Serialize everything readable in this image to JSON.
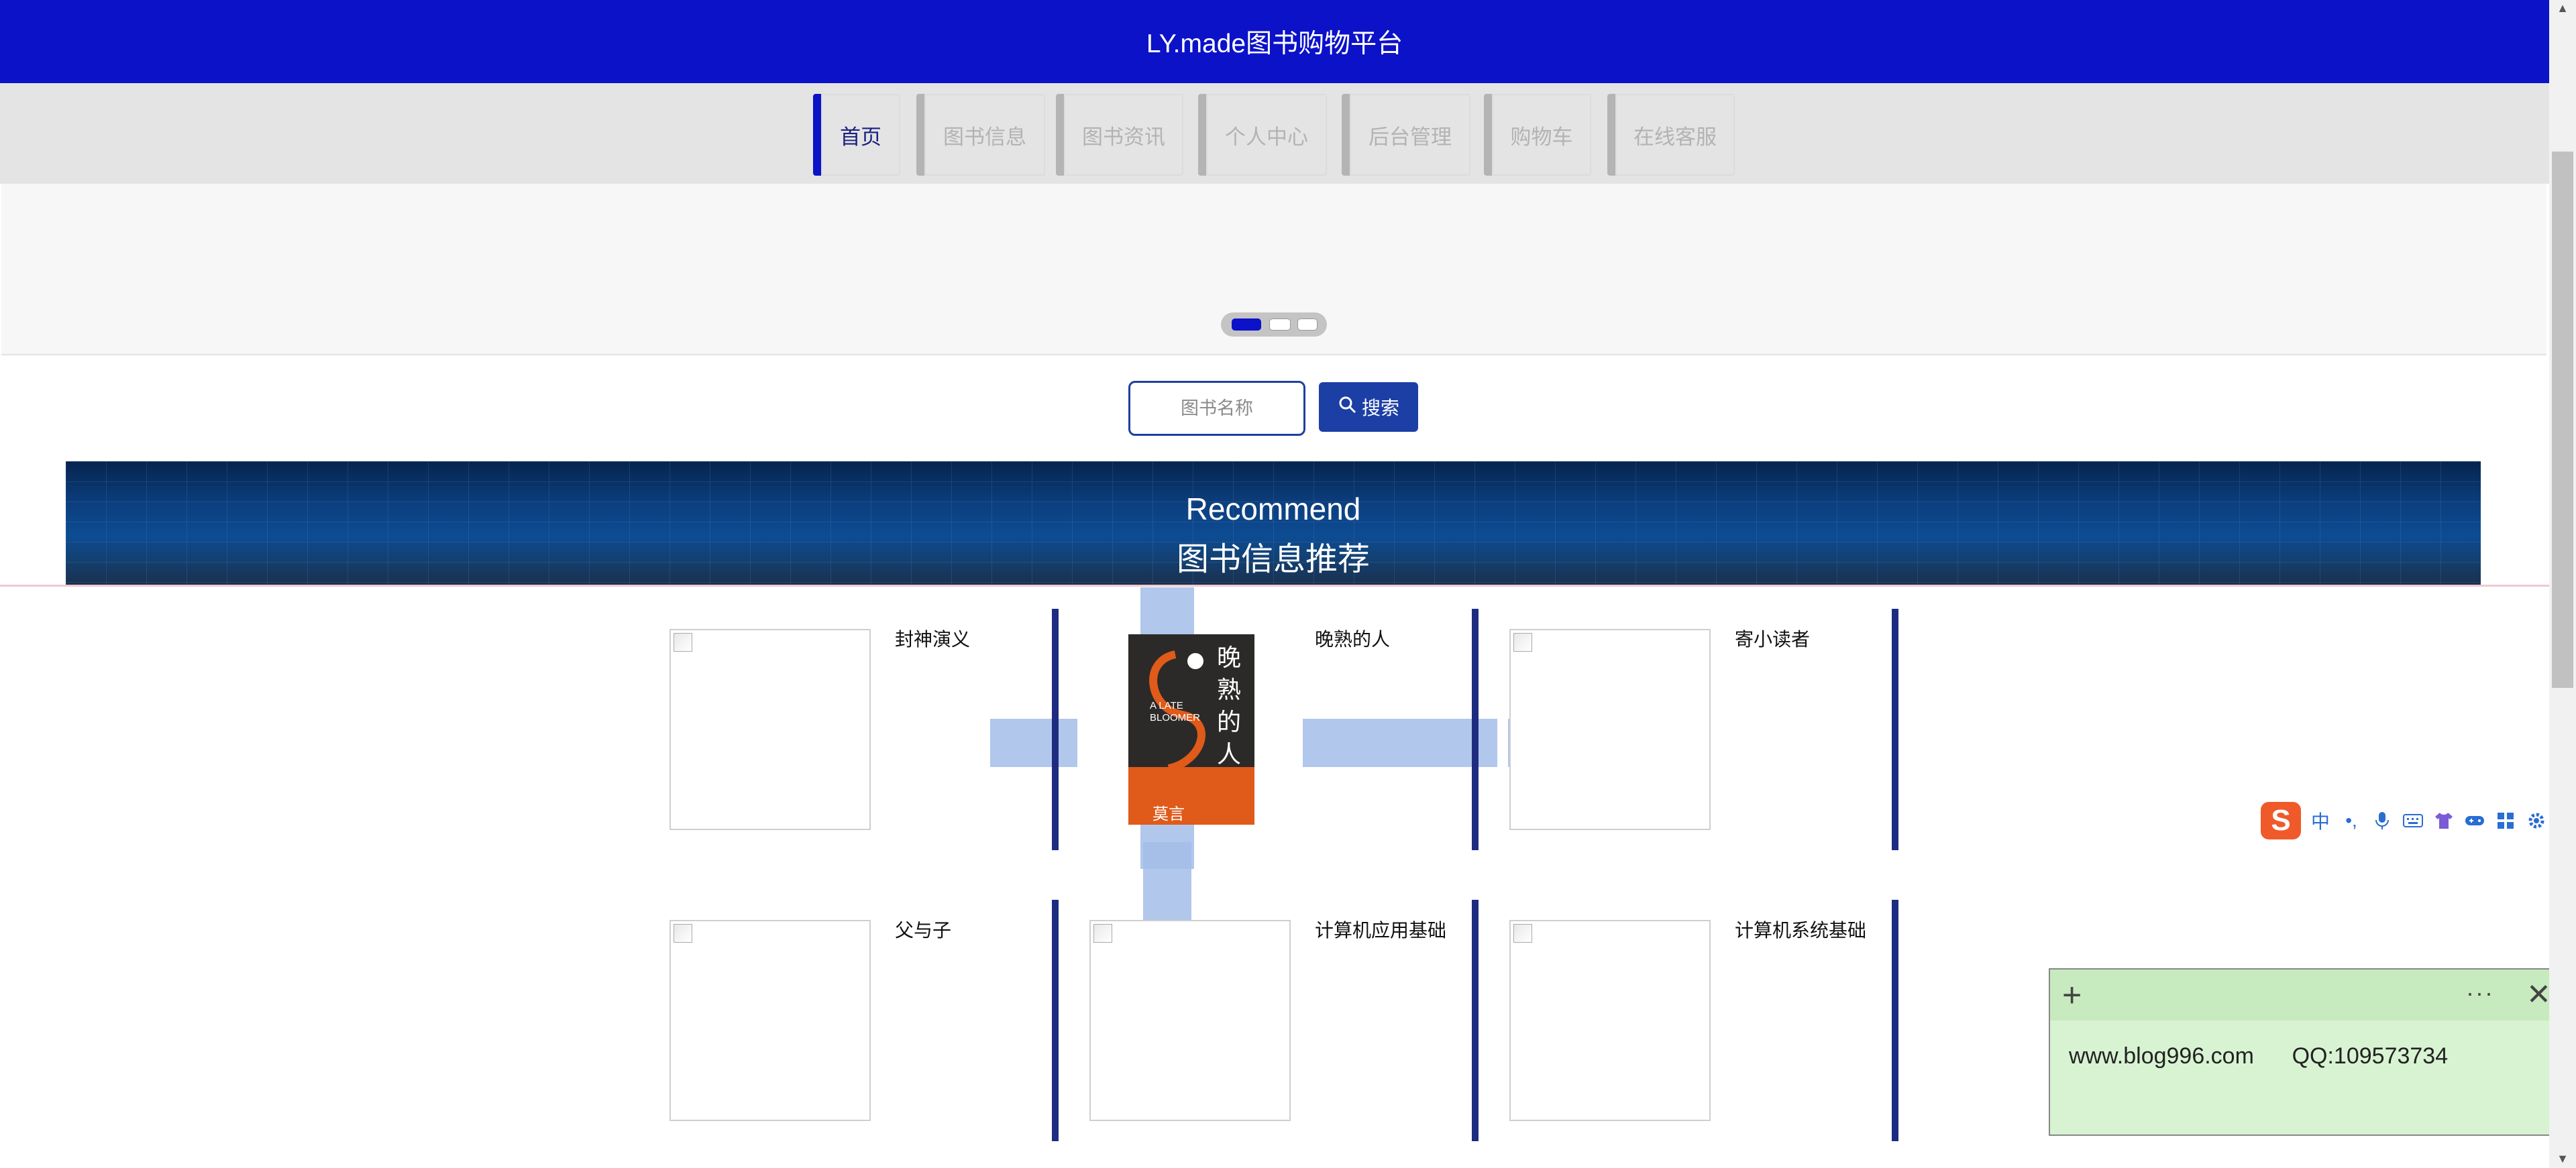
{
  "header": {
    "title": "LY.made图书购物平台"
  },
  "nav": {
    "items": [
      {
        "label": "首页"
      },
      {
        "label": "图书信息"
      },
      {
        "label": "图书资讯"
      },
      {
        "label": "个人中心"
      },
      {
        "label": "后台管理"
      },
      {
        "label": "购物车"
      },
      {
        "label": "在线客服"
      }
    ]
  },
  "search": {
    "placeholder": "图书名称",
    "button_label": "搜索"
  },
  "recommend": {
    "title_en": "Recommend",
    "title_zh": "图书信息推荐"
  },
  "books": [
    {
      "name": "封神演义"
    },
    {
      "name": "晚熟的人"
    },
    {
      "name": "寄小读者"
    },
    {
      "name": "父与子"
    },
    {
      "name": "计算机应用基础"
    },
    {
      "name": "计算机系统基础"
    }
  ],
  "cover": {
    "title": "晚熟的人",
    "subtitle": "A LATE BLOOMER",
    "author": "莫言"
  },
  "sticky_note": {
    "text": "www.blog996.com      QQ:109573734"
  },
  "ime": {
    "logo": "S",
    "mode": "中"
  }
}
